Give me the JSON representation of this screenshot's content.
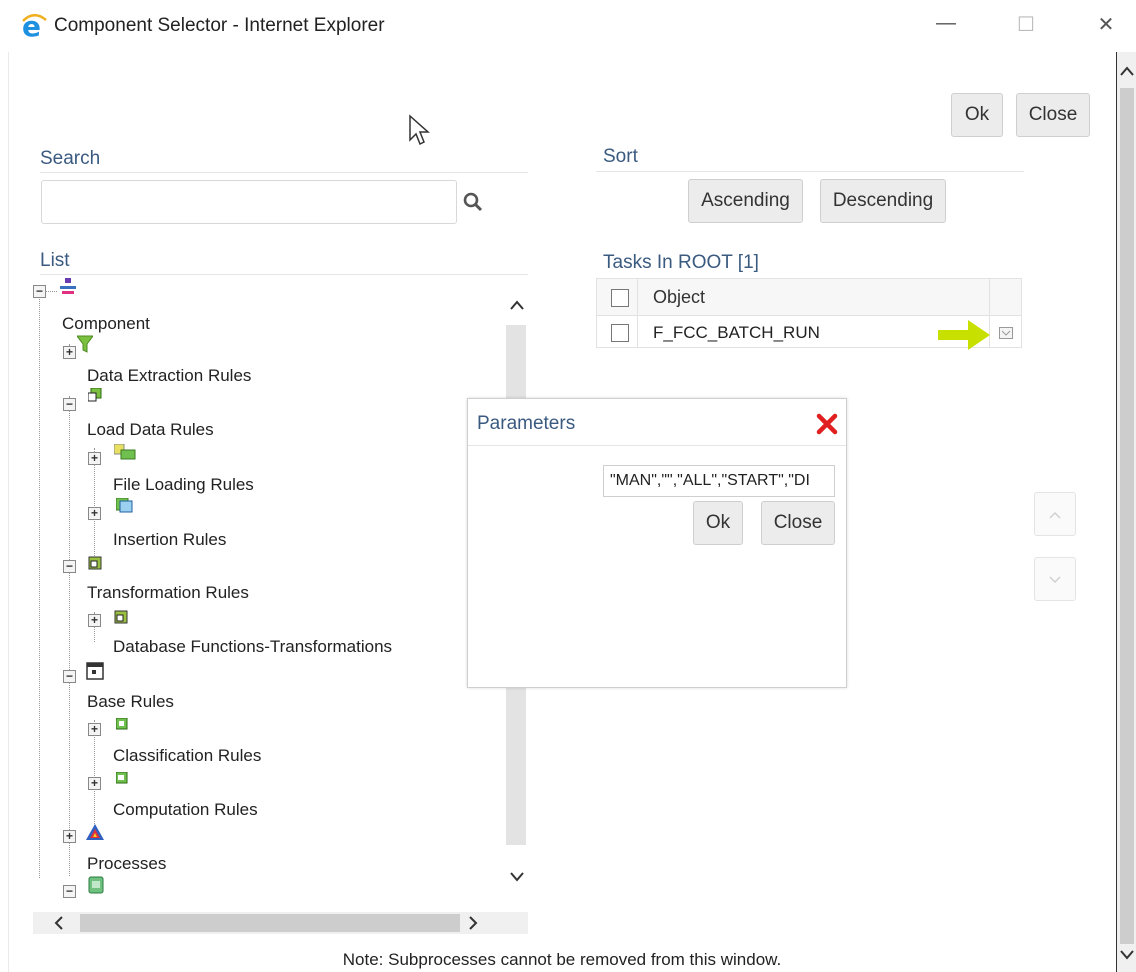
{
  "window": {
    "title": "Component Selector - Internet Explorer",
    "minimize_glyph": "—",
    "maximize_glyph": "☐",
    "close_glyph": "✕"
  },
  "toolbar": {
    "ok_label": "Ok",
    "close_label": "Close"
  },
  "search": {
    "label": "Search",
    "value": "",
    "placeholder": ""
  },
  "sort": {
    "label": "Sort",
    "ascending_label": "Ascending",
    "descending_label": "Descending"
  },
  "list": {
    "label": "List",
    "tree": [
      {
        "label": "Component",
        "icon": "filter-icon"
      },
      {
        "label": "Data Extraction Rules",
        "icon": "database-icon"
      },
      {
        "label": "Load Data Rules",
        "icon": "file-load-icon"
      },
      {
        "label": "File Loading Rules",
        "icon": "insertion-icon"
      },
      {
        "label": "Insertion Rules",
        "icon": "transform-icon"
      },
      {
        "label": "Transformation Rules",
        "icon": "function-icon"
      },
      {
        "label": "Database Functions-Transformations",
        "icon": "base-rules-icon"
      },
      {
        "label": "Base Rules",
        "icon": "classification-icon"
      },
      {
        "label": "Classification Rules",
        "icon": "computation-icon"
      },
      {
        "label": "Computation Rules",
        "icon": "pyramid-icon"
      },
      {
        "label": "Processes",
        "icon": "process-icon"
      }
    ]
  },
  "tasks": {
    "label": "Tasks In ROOT [1]",
    "column_header": "Object",
    "rows": [
      {
        "object": "F_FCC_BATCH_RUN"
      }
    ]
  },
  "parameters_dialog": {
    "title": "Parameters",
    "value": "\"MAN\",\"\",\"ALL\",\"START\",\"DI",
    "ok_label": "Ok",
    "close_label": "Close"
  },
  "note": "Note: Subprocesses cannot be removed from this window.",
  "colors": {
    "section_label": "#3a5a80",
    "close_x": "#e02020",
    "pointer_arrow": "#c8e000"
  }
}
